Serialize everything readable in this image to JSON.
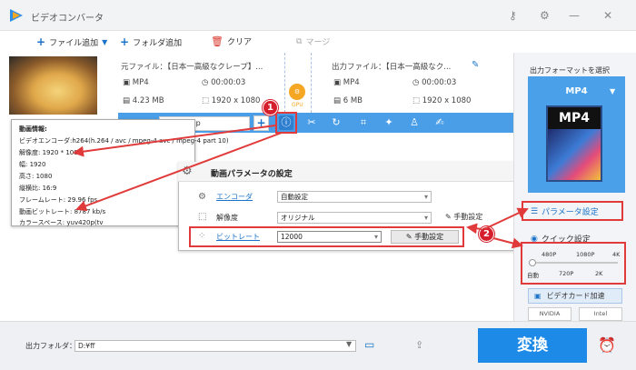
{
  "window": {
    "title": "ビデオコンバータ"
  },
  "toolbar": {
    "add_file": "ファイル追加",
    "add_folder": "フォルダ追加",
    "clear": "クリア",
    "merge": "マージ"
  },
  "file": {
    "source_label": "元ファイル：【日本一高級なクレープ】...",
    "output_label": "出力ファイル：【日本一高級なク...",
    "src_format": "MP4",
    "src_duration": "00:00:03",
    "src_size": "4.23 MB",
    "src_resolution": "1920 x 1080",
    "out_format": "MP4",
    "out_duration": "00:00:03",
    "out_size": "6 MB",
    "out_resolution": "1920 x 1080",
    "gpu_badge": "GPU"
  },
  "strip": {
    "audio_combo": "c (LC) (mp",
    "plus": "+"
  },
  "popup": {
    "lines": [
      "動画情報:",
      "ビデオエンコーダ:h264(h.264 / avc / mpeg-4 avc / mpeg-4 part 10)",
      "解像度: 1920 * 1080",
      "幅: 1920",
      "高さ: 1080",
      "縦横比: 16:9",
      "フレームレート: 29.96 fps",
      "動画ビットレート: 8787 kb/s",
      "カラースペース: yuv420p(tv"
    ]
  },
  "dialog": {
    "title": "動画パラメータの設定",
    "encoder_label": "エンコーダ",
    "encoder_value": "自動設定",
    "resolution_label": "解像度",
    "resolution_value": "オリジナル",
    "bitrate_label": "ビットレート",
    "bitrate_value": "12000",
    "manual_btn": "手動設定",
    "manual_btn2": "手動設定"
  },
  "right": {
    "choose_format": "出力フォーマットを選択",
    "format": "MP4",
    "mp4_text": "MP4",
    "param_settings": "パラメータ設定",
    "quick_settings": "クイック設定",
    "top_ticks": [
      "480P",
      "1080P",
      "4K"
    ],
    "bottom_ticks": [
      "自動",
      "720P",
      "2K"
    ],
    "quality_level": 0,
    "accel": "ビデオカード加速",
    "chips": [
      "NVIDIA",
      "Intel"
    ]
  },
  "bottom": {
    "output_folder_label": "出力フォルダ：",
    "output_folder_value": "D:¥ff",
    "convert": "変換"
  },
  "badges": [
    "1",
    "2"
  ],
  "colors": {
    "accent": "#1d8ae8",
    "strip": "#4a9ee8",
    "annotation": "#e03a3a"
  }
}
